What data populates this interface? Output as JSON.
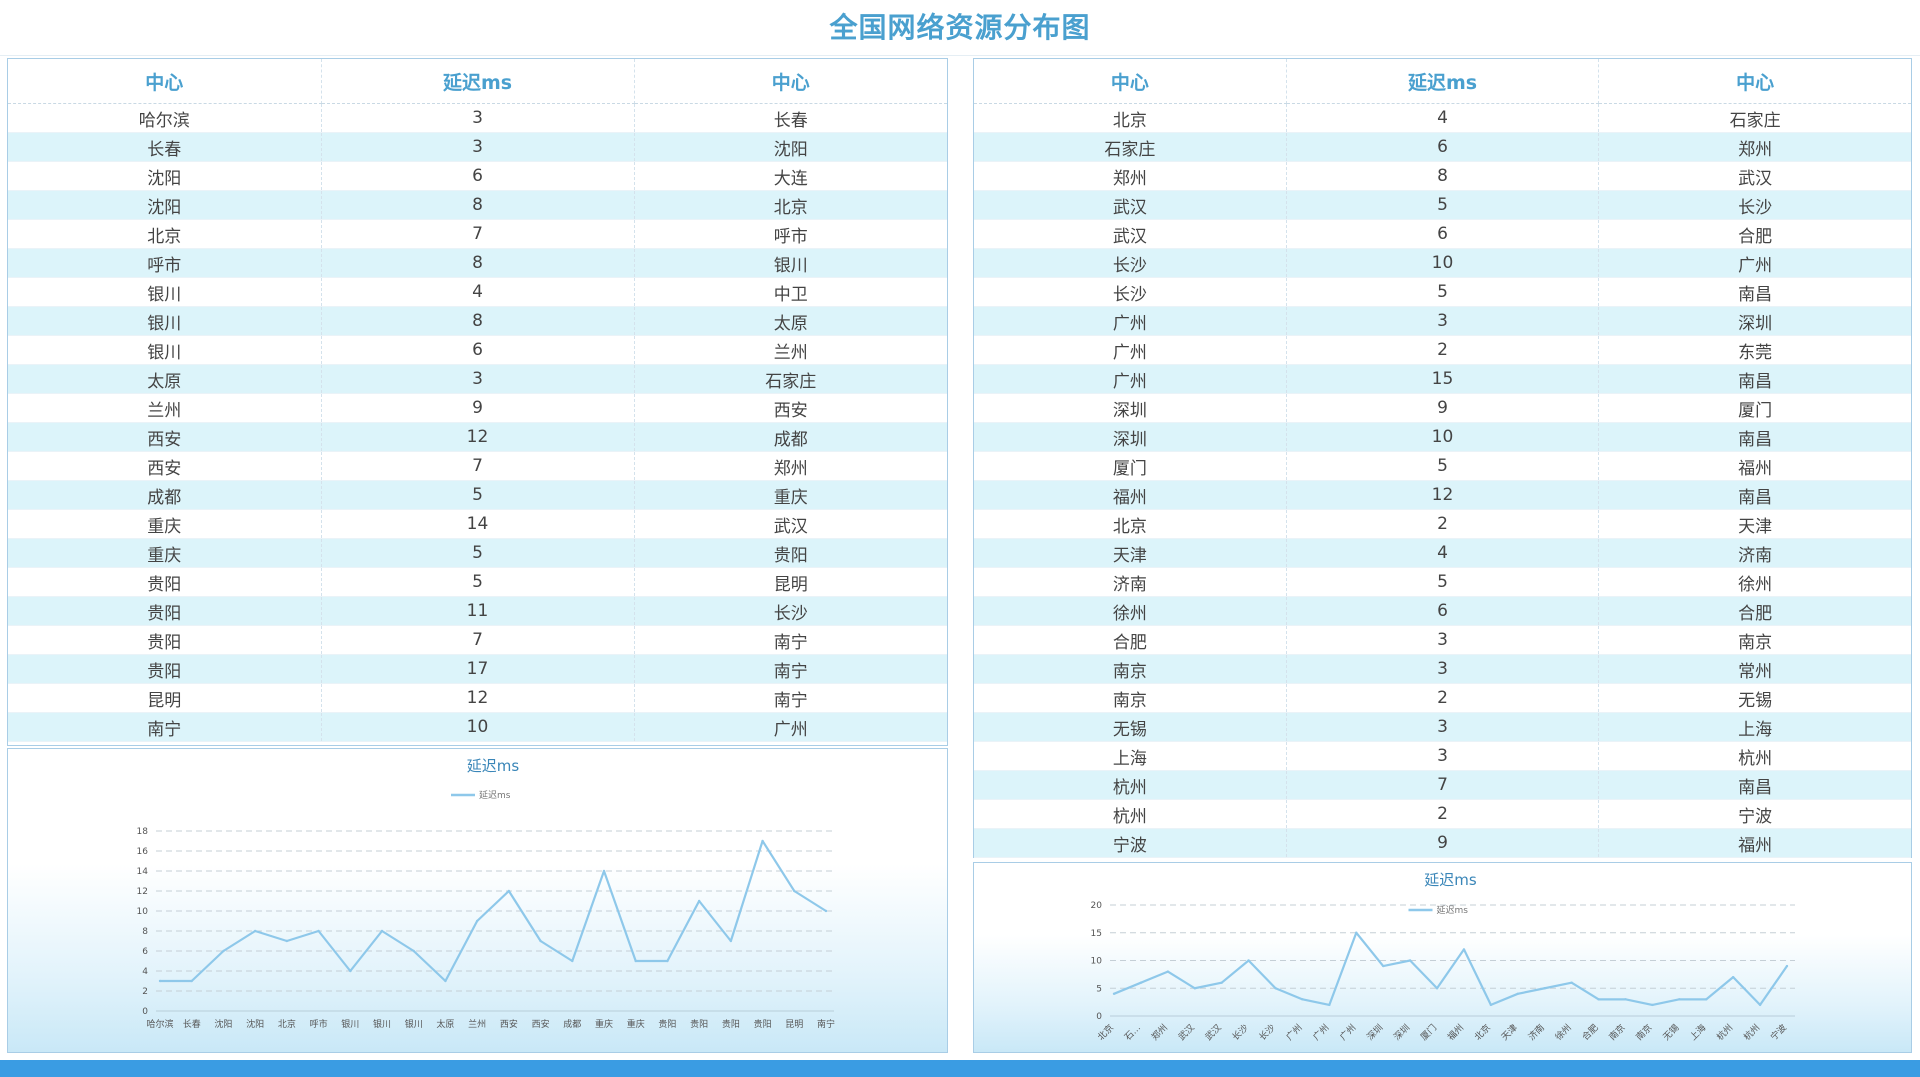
{
  "page": {
    "title": "全国网络资源分布图"
  },
  "left_table": {
    "headers": [
      "中心",
      "延迟ms",
      "中心"
    ],
    "rows": [
      [
        "哈尔滨",
        "3",
        "长春"
      ],
      [
        "长春",
        "3",
        "沈阳"
      ],
      [
        "沈阳",
        "6",
        "大连"
      ],
      [
        "沈阳",
        "8",
        "北京"
      ],
      [
        "北京",
        "7",
        "呼市"
      ],
      [
        "呼市",
        "8",
        "银川"
      ],
      [
        "银川",
        "4",
        "中卫"
      ],
      [
        "银川",
        "8",
        "太原"
      ],
      [
        "银川",
        "6",
        "兰州"
      ],
      [
        "太原",
        "3",
        "石家庄"
      ],
      [
        "兰州",
        "9",
        "西安"
      ],
      [
        "西安",
        "12",
        "成都"
      ],
      [
        "西安",
        "7",
        "郑州"
      ],
      [
        "成都",
        "5",
        "重庆"
      ],
      [
        "重庆",
        "14",
        "武汉"
      ],
      [
        "重庆",
        "5",
        "贵阳"
      ],
      [
        "贵阳",
        "5",
        "昆明"
      ],
      [
        "贵阳",
        "11",
        "长沙"
      ],
      [
        "贵阳",
        "7",
        "南宁"
      ],
      [
        "贵阳",
        "17",
        "南宁"
      ],
      [
        "昆明",
        "12",
        "南宁"
      ],
      [
        "南宁",
        "10",
        "广州"
      ]
    ]
  },
  "right_table": {
    "headers": [
      "中心",
      "延迟ms",
      "中心"
    ],
    "rows": [
      [
        "北京",
        "4",
        "石家庄"
      ],
      [
        "石家庄",
        "6",
        "郑州"
      ],
      [
        "郑州",
        "8",
        "武汉"
      ],
      [
        "武汉",
        "5",
        "长沙"
      ],
      [
        "武汉",
        "6",
        "合肥"
      ],
      [
        "长沙",
        "10",
        "广州"
      ],
      [
        "长沙",
        "5",
        "南昌"
      ],
      [
        "广州",
        "3",
        "深圳"
      ],
      [
        "广州",
        "2",
        "东莞"
      ],
      [
        "广州",
        "15",
        "南昌"
      ],
      [
        "深圳",
        "9",
        "厦门"
      ],
      [
        "深圳",
        "10",
        "南昌"
      ],
      [
        "厦门",
        "5",
        "福州"
      ],
      [
        "福州",
        "12",
        "南昌"
      ],
      [
        "北京",
        "2",
        "天津"
      ],
      [
        "天津",
        "4",
        "济南"
      ],
      [
        "济南",
        "5",
        "徐州"
      ],
      [
        "徐州",
        "6",
        "合肥"
      ],
      [
        "合肥",
        "3",
        "南京"
      ],
      [
        "南京",
        "3",
        "常州"
      ],
      [
        "南京",
        "2",
        "无锡"
      ],
      [
        "无锡",
        "3",
        "上海"
      ],
      [
        "上海",
        "3",
        "杭州"
      ],
      [
        "杭州",
        "7",
        "南昌"
      ],
      [
        "杭州",
        "2",
        "宁波"
      ],
      [
        "宁波",
        "9",
        "福州"
      ]
    ]
  },
  "chart_data": [
    {
      "type": "line",
      "title": "延迟ms",
      "legend": "top-center",
      "line_color": "#8ec8ea",
      "series": [
        {
          "name": "延迟ms",
          "values": [
            3,
            3,
            6,
            8,
            7,
            8,
            4,
            8,
            6,
            3,
            9,
            12,
            7,
            5,
            14,
            5,
            5,
            11,
            7,
            17,
            12,
            10
          ]
        }
      ],
      "categories": [
        "哈尔滨",
        "长春",
        "沈阳",
        "沈阳",
        "北京",
        "呼市",
        "银川",
        "银川",
        "银川",
        "太原",
        "兰州",
        "西安",
        "西安",
        "成都",
        "重庆",
        "重庆",
        "贵阳",
        "贵阳",
        "贵阳",
        "贵阳",
        "昆明",
        "南宁"
      ],
      "ylim": [
        0,
        18
      ],
      "yticks": [
        0,
        2,
        4,
        6,
        8,
        10,
        12,
        14,
        16,
        18
      ],
      "grid": true
    },
    {
      "type": "line",
      "title": "延迟ms",
      "legend": "top-center",
      "line_color": "#8ec8ea",
      "series": [
        {
          "name": "延迟ms",
          "values": [
            4,
            6,
            8,
            5,
            6,
            10,
            5,
            3,
            2,
            15,
            9,
            10,
            5,
            12,
            2,
            4,
            5,
            6,
            3,
            3,
            2,
            3,
            3,
            7,
            2,
            9
          ]
        }
      ],
      "categories": [
        "北京",
        "石…",
        "郑州",
        "武汉",
        "武汉",
        "长沙",
        "长沙",
        "广州",
        "广州",
        "广州",
        "深圳",
        "深圳",
        "厦门",
        "福州",
        "北京",
        "天津",
        "济南",
        "徐州",
        "合肥",
        "南京",
        "南京",
        "无锡",
        "上海",
        "杭州",
        "杭州",
        "宁波"
      ],
      "ylim": [
        0,
        20
      ],
      "yticks": [
        0,
        5,
        10,
        15,
        20
      ],
      "grid": true
    }
  ]
}
